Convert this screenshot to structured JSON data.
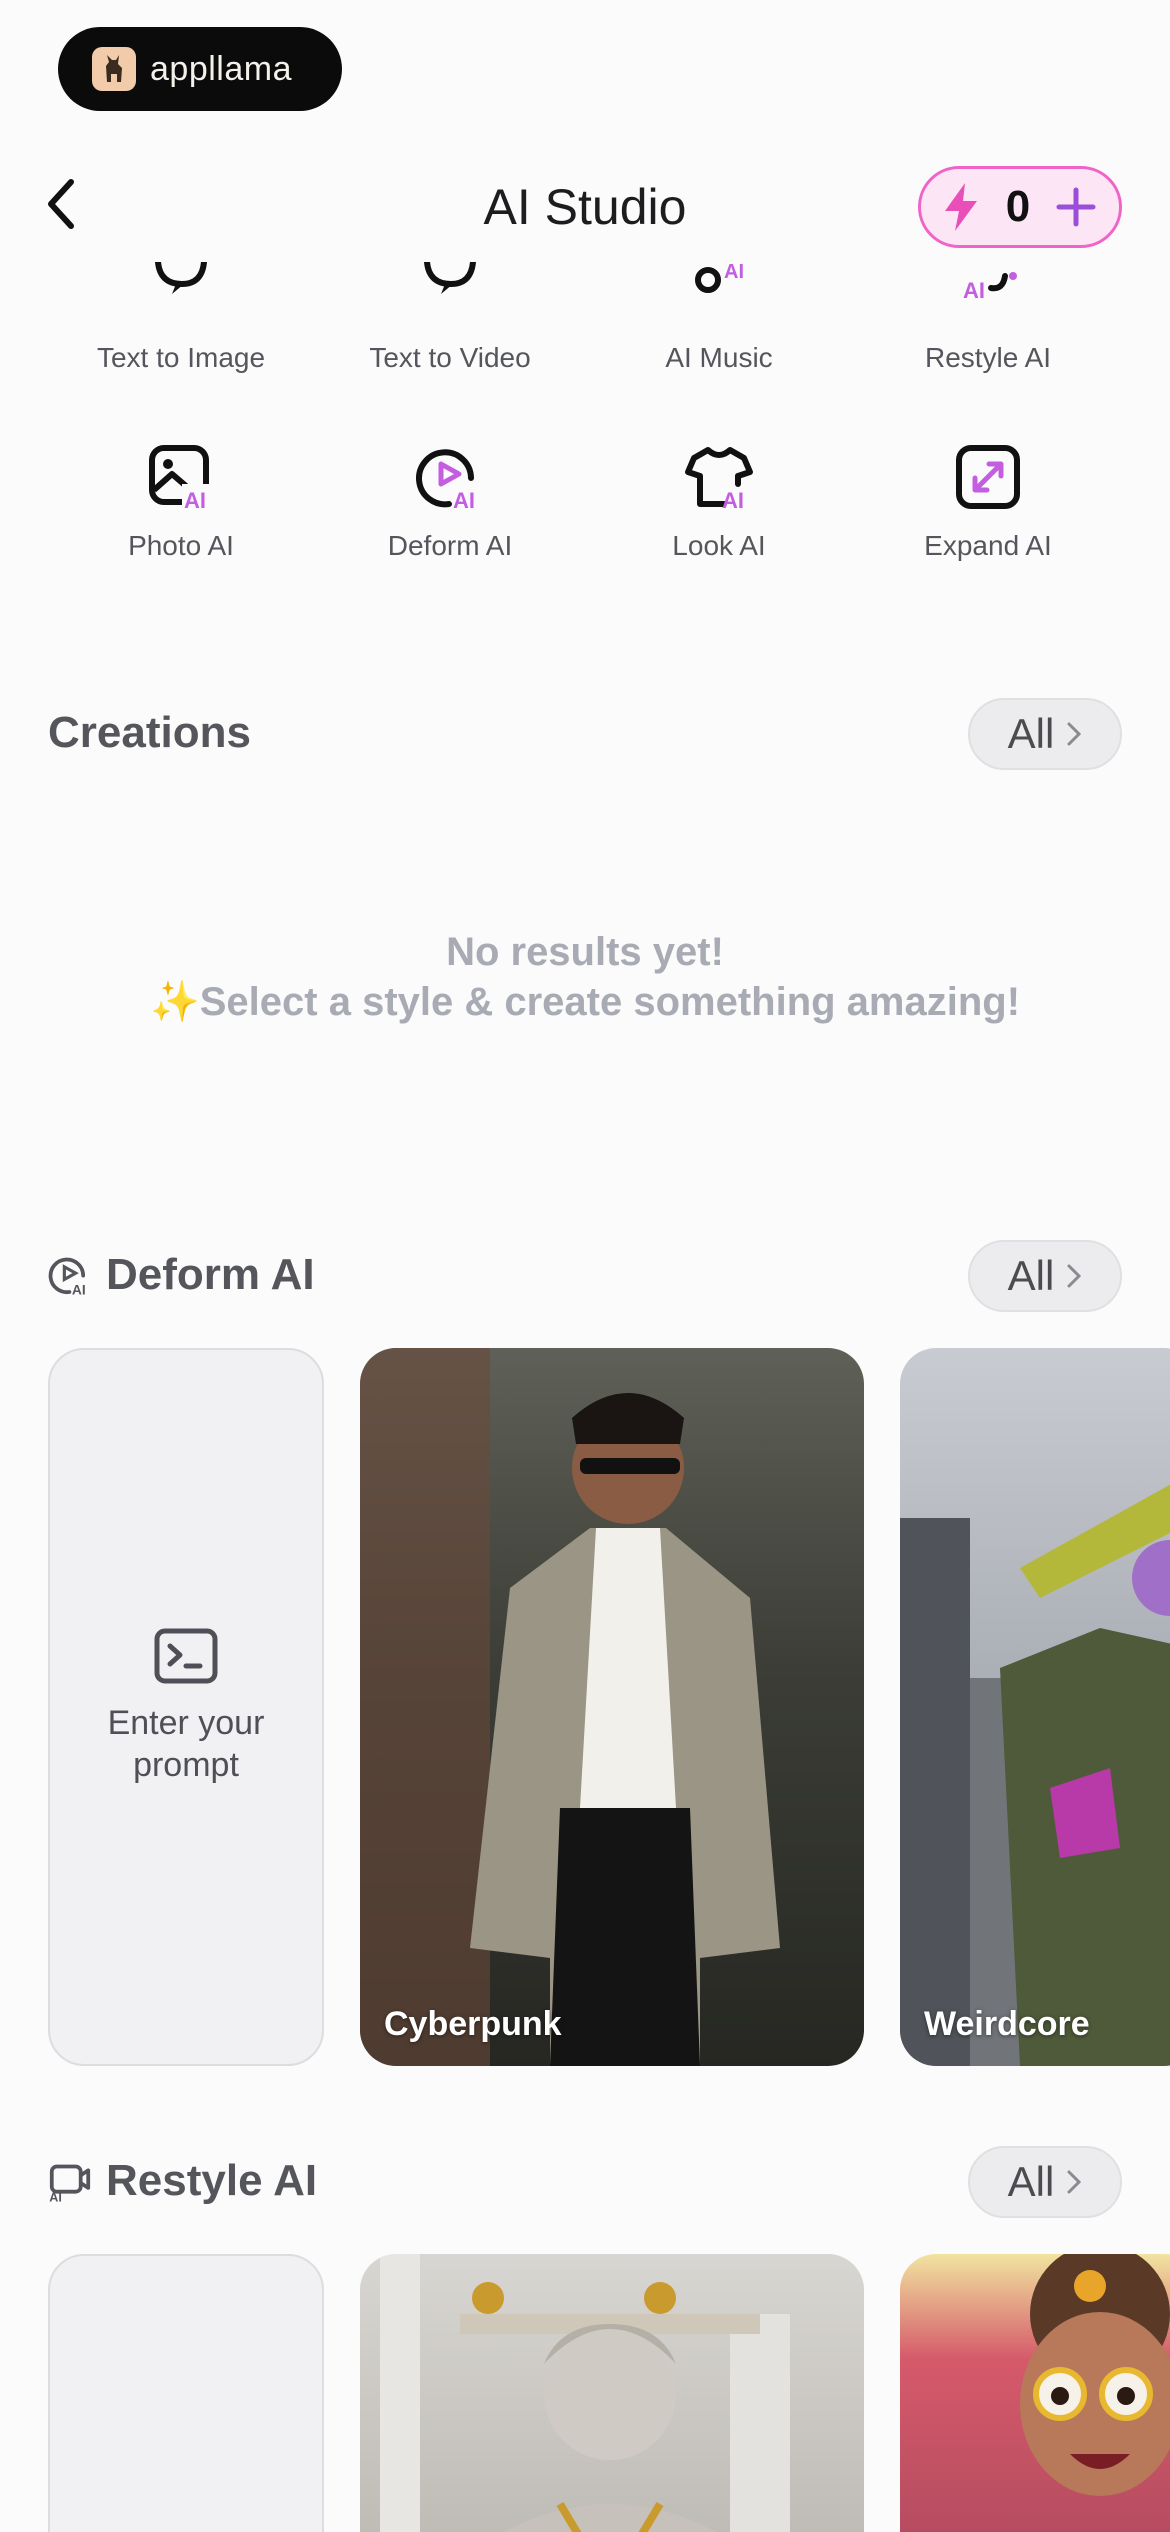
{
  "brand": {
    "name": "appllama"
  },
  "header": {
    "title": "AI Studio",
    "credits": "0"
  },
  "tools": [
    {
      "label": "Text to Image",
      "icon": "chat-bubble-icon"
    },
    {
      "label": "Text to Video",
      "icon": "chat-bubble-icon"
    },
    {
      "label": "AI Music",
      "icon": "music-note-icon"
    },
    {
      "label": "Restyle AI",
      "icon": "restyle-icon"
    },
    {
      "label": "Photo AI",
      "icon": "photo-ai-icon"
    },
    {
      "label": "Deform AI",
      "icon": "deform-ai-icon"
    },
    {
      "label": "Look AI",
      "icon": "shirt-ai-icon"
    },
    {
      "label": "Expand AI",
      "icon": "expand-icon"
    }
  ],
  "creations": {
    "title": "Creations",
    "all_label": "All",
    "empty_line1": "No results yet!",
    "empty_line2": "✨Select a style & create something amazing!"
  },
  "deform": {
    "title": "Deform AI",
    "all_label": "All",
    "prompt_label": "Enter your prompt",
    "cards": [
      {
        "label": "Cyberpunk"
      },
      {
        "label": "Weirdcore"
      }
    ]
  },
  "restyle": {
    "title": "Restyle AI",
    "all_label": "All"
  },
  "colors": {
    "accent": "#e86bd0",
    "credit_border": "#f064c8",
    "ai_badge": "#c35ee0"
  }
}
